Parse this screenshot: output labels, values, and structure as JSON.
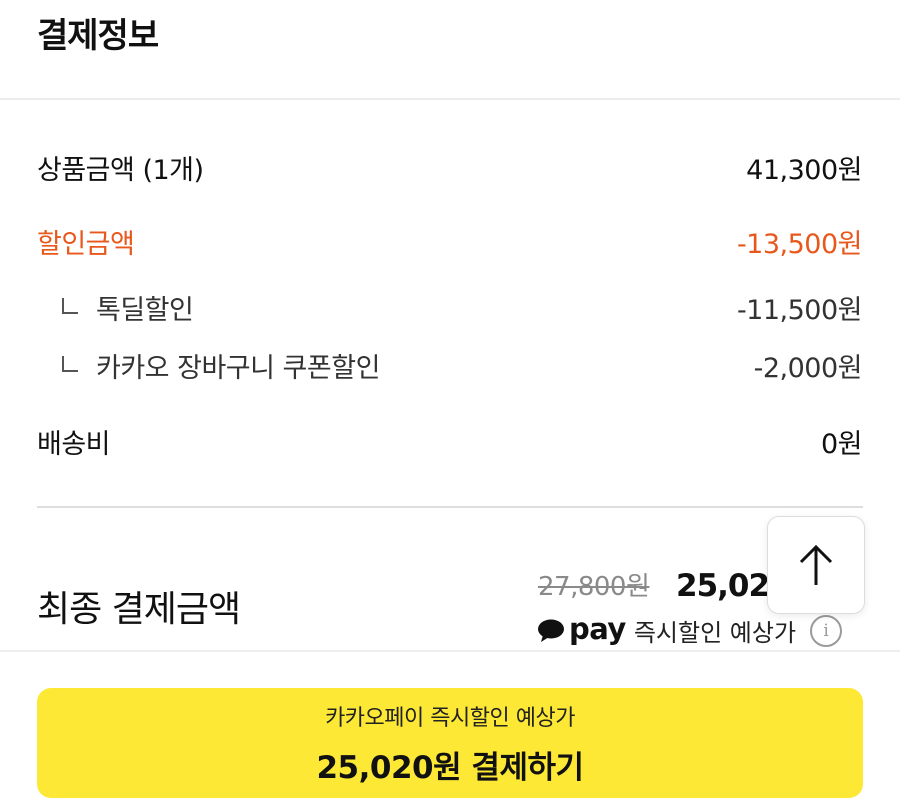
{
  "section": {
    "title": "결제정보"
  },
  "breakdown": {
    "product_label": "상품금액 (1개)",
    "product_value": "41,300원",
    "discount_label": "할인금액",
    "discount_value": "-13,500원",
    "discount_items": [
      {
        "label": "톡딜할인",
        "value": "-11,500원"
      },
      {
        "label": "카카오 장바구니 쿠폰할인",
        "value": "-2,000원"
      }
    ],
    "shipping_label": "배송비",
    "shipping_value": "0원"
  },
  "final": {
    "label": "최종 결제금액",
    "original_price": "27,800원",
    "price": "25,020원",
    "pay_brand": "pay",
    "pay_note": "즉시할인 예상가",
    "info_icon": "info-icon"
  },
  "scroll_top": {
    "icon": "arrow-up-icon"
  },
  "pay_button": {
    "sub_label": "카카오페이 즉시할인 예상가",
    "main_label": "25,020원 결제하기"
  },
  "colors": {
    "discount": "#e8581d",
    "button_bg": "#fde835",
    "text": "#111111"
  }
}
